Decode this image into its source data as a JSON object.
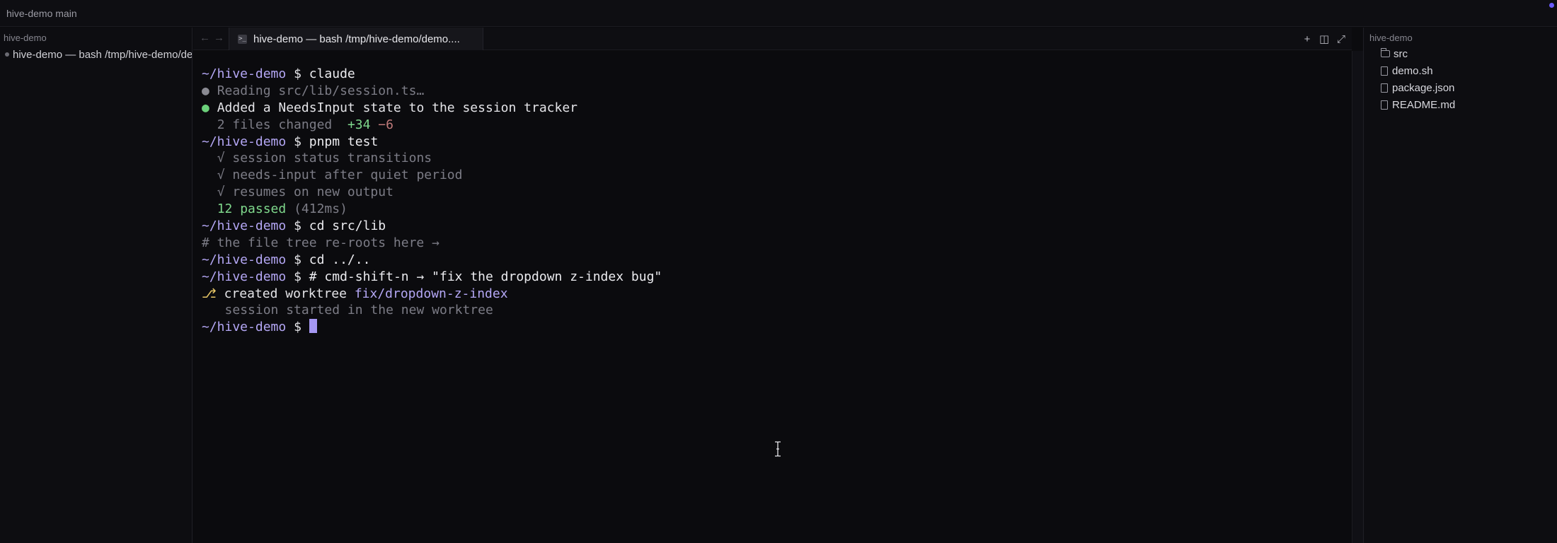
{
  "window": {
    "title": "hive-demo main"
  },
  "left_sidebar": {
    "header": "hive-demo",
    "sessions": [
      {
        "label": "hive-demo — bash /tmp/hive-demo/demo.sh"
      }
    ]
  },
  "tabs": {
    "back": "←",
    "forward": "→",
    "active": {
      "icon_glyph": ">_",
      "label": "hive-demo — bash /tmp/hive-demo/demo...."
    },
    "actions": {
      "new": "+",
      "split": "◫",
      "expand": "⤢"
    }
  },
  "terminal": {
    "prompt_path": "~/hive-demo",
    "prompt_symbol": "$",
    "lines": {
      "l1_cmd": "claude",
      "l2_bullet": "●",
      "l2_text": "Reading src/lib/session.ts…",
      "l3_bullet": "●",
      "l3_text": "Added a NeedsInput state to the session tracker",
      "l4_text": "2 files changed",
      "l4_add": "+34",
      "l4_del": "−6",
      "l5_cmd": "pnpm test",
      "l6_text": "√ session status transitions",
      "l7_text": "√ needs-input after quiet period",
      "l8_text": "√ resumes on new output",
      "l9_passed": "12 passed",
      "l9_time": "(412ms)",
      "l10_cmd": "cd src/lib",
      "l11_comment": "# the file tree re-roots here →",
      "l12_cmd": "cd ../..",
      "l13_cmd": "# cmd-shift-n → \"fix the dropdown z-index bug\"",
      "l14_icon": "⎇",
      "l14_text": "created worktree",
      "l14_branch": "fix/dropdown-z-index",
      "l15_text": "session started in the new worktree"
    }
  },
  "right_sidebar": {
    "header": "hive-demo",
    "files": [
      {
        "name": "src",
        "kind": "folder"
      },
      {
        "name": "demo.sh",
        "kind": "file"
      },
      {
        "name": "package.json",
        "kind": "file"
      },
      {
        "name": "README.md",
        "kind": "file"
      }
    ]
  },
  "colors": {
    "background": "#0b0b0e",
    "prompt": "#b4a7f5",
    "success": "#7fd88c",
    "cursor": "#a597f2"
  }
}
